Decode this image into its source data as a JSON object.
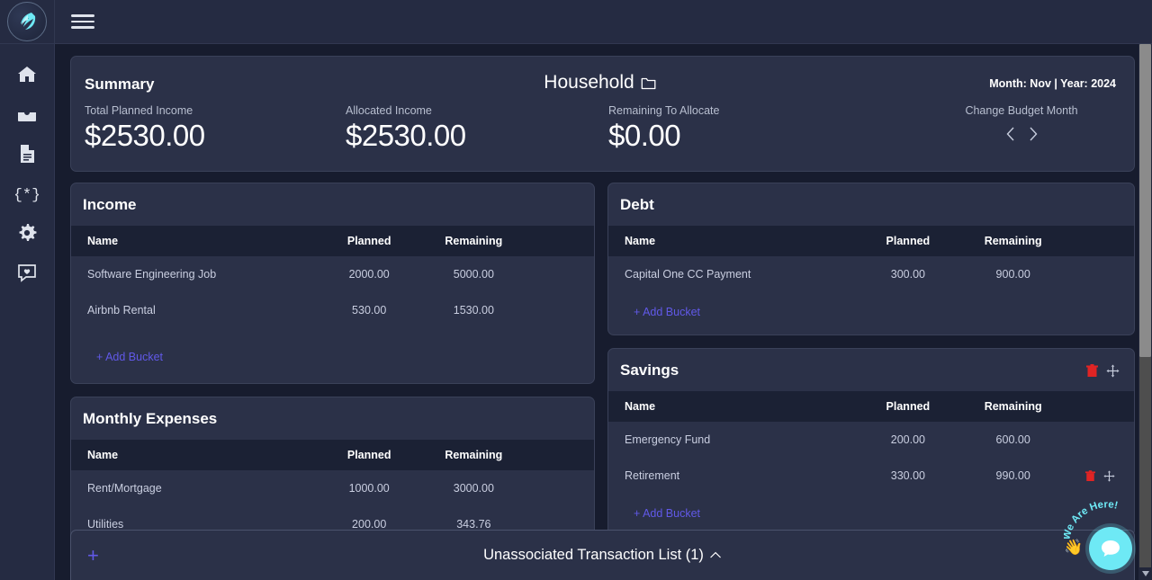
{
  "app": {
    "logo_icon": "bird-logo-icon",
    "menu_icon": "hamburger-menu-icon"
  },
  "sidebar": {
    "items": [
      {
        "icon": "home-icon",
        "name": "sidebar-item-home"
      },
      {
        "icon": "inbox-icon",
        "name": "sidebar-item-inbox"
      },
      {
        "icon": "document-icon",
        "name": "sidebar-item-documents"
      },
      {
        "icon": "code-icon",
        "name": "sidebar-item-code"
      },
      {
        "icon": "gear-icon",
        "name": "sidebar-item-settings"
      },
      {
        "icon": "feedback-heart-icon",
        "name": "sidebar-item-feedback"
      }
    ]
  },
  "summary": {
    "title": "Summary",
    "household_label": "Household",
    "household_icon": "folder-icon",
    "month_year": "Month: Nov | Year: 2024",
    "metrics": [
      {
        "label": "Total Planned Income",
        "value": "$2530.00"
      },
      {
        "label": "Allocated Income",
        "value": "$2530.00"
      },
      {
        "label": "Remaining To Allocate",
        "value": "$0.00"
      }
    ],
    "change_month_label": "Change Budget Month",
    "prev_icon": "chevron-left-icon",
    "next_icon": "chevron-right-icon"
  },
  "columns": {
    "name": "Name",
    "planned": "Planned",
    "remaining": "Remaining"
  },
  "add_bucket_label": "+ Add Bucket",
  "panels": {
    "income": {
      "title": "Income",
      "rows": [
        {
          "name": "Software Engineering Job",
          "planned": "2000.00",
          "remaining": "5000.00"
        },
        {
          "name": "Airbnb Rental",
          "planned": "530.00",
          "remaining": "1530.00"
        }
      ]
    },
    "expenses": {
      "title": "Monthly Expenses",
      "rows": [
        {
          "name": "Rent/Mortgage",
          "planned": "1000.00",
          "remaining": "3000.00"
        },
        {
          "name": "Utilities",
          "planned": "200.00",
          "remaining": "343.76"
        }
      ]
    },
    "debt": {
      "title": "Debt",
      "rows": [
        {
          "name": "Capital One CC Payment",
          "planned": "300.00",
          "remaining": "900.00"
        }
      ]
    },
    "savings": {
      "title": "Savings",
      "header_tools": {
        "delete_icon": "trash-icon",
        "move_icon": "move-arrows-icon"
      },
      "rows": [
        {
          "name": "Emergency Fund",
          "planned": "200.00",
          "remaining": "600.00",
          "tools": false
        },
        {
          "name": "Retirement",
          "planned": "330.00",
          "remaining": "990.00",
          "tools": true
        }
      ]
    }
  },
  "bottom_bar": {
    "add_icon": "plus-icon",
    "title": "Unassociated Transaction List (1)",
    "collapse_icon": "chevron-up-icon"
  },
  "chat_widget": {
    "badge_text": "We Are Here!",
    "hand_icon": "waving-hand-icon",
    "bubble_icon": "chat-bubble-icon"
  },
  "colors": {
    "page_bg": "#171c2e",
    "panel_bg": "#2b3148",
    "table_header_bg": "#1b2134",
    "sidebar_bg": "#252b42",
    "accent_link": "#6159e8",
    "danger": "#e02424",
    "chat_accent": "#6ee9f5"
  }
}
